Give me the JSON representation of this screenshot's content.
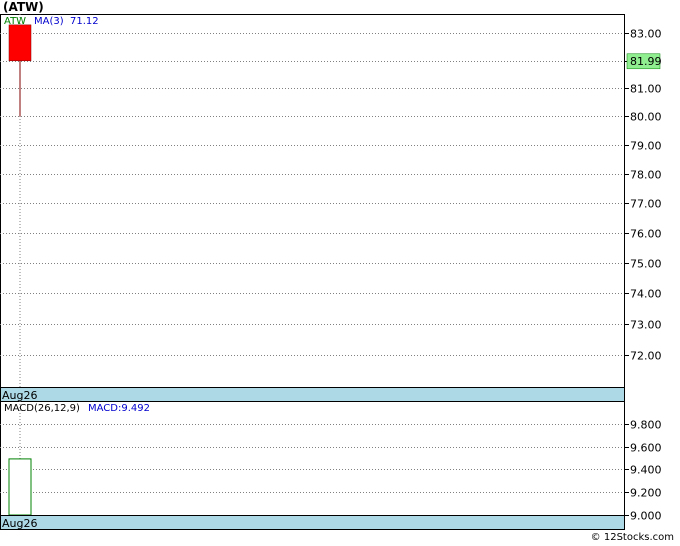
{
  "title": "(ATW)",
  "footer": "© 12Stocks.com",
  "chart_data": [
    {
      "type": "candlestick",
      "legend": {
        "symbol": "ATW",
        "ma_label": "MA(3)",
        "ma_value": "71.12"
      },
      "candles": [
        {
          "date": "Aug26",
          "open": 83.3,
          "high": 83.3,
          "low": 80.0,
          "close": 81.99,
          "color": "#ff0000"
        }
      ],
      "last_price": "81.99",
      "yticks": [
        "83.00",
        "82.00",
        "81.00",
        "80.00",
        "79.00",
        "78.00",
        "77.00",
        "76.00",
        "75.00",
        "74.00",
        "73.00",
        "72.00"
      ],
      "ylim": [
        71.0,
        83.7
      ],
      "scale": "log",
      "xlabel": "Aug26",
      "grid": true
    },
    {
      "type": "bar",
      "legend": {
        "label": "MACD(26,12,9)",
        "value_label": "MACD:9.492"
      },
      "categories": [
        "Aug26"
      ],
      "values": [
        9.492
      ],
      "yticks": [
        "9.800",
        "9.600",
        "9.400",
        "9.200",
        "9.000"
      ],
      "ylim": [
        9.0,
        10.0
      ],
      "xlabel": "Aug26",
      "grid": true
    }
  ],
  "colors": {
    "axis_band": "#add8e6",
    "price_tag": "#90ee90",
    "grid": "#808080",
    "legend_symbol": "#008000",
    "legend_ma": "#0000cd"
  }
}
